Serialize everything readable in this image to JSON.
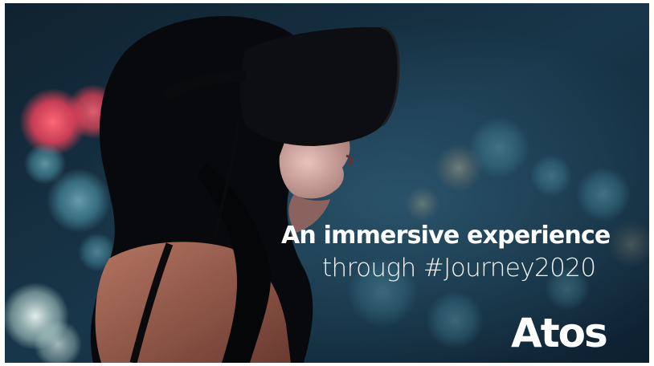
{
  "headline": "An immersive experience",
  "subline": "through #Journey2020",
  "logo": {
    "text": "Atos",
    "color": "#ffffff"
  },
  "photo": {
    "subject": "woman-wearing-vr-headset",
    "colors": {
      "bokeh_red": "#e8425a",
      "bokeh_teal": "#5fb6c8",
      "night_sky": "#0b1a26"
    }
  }
}
